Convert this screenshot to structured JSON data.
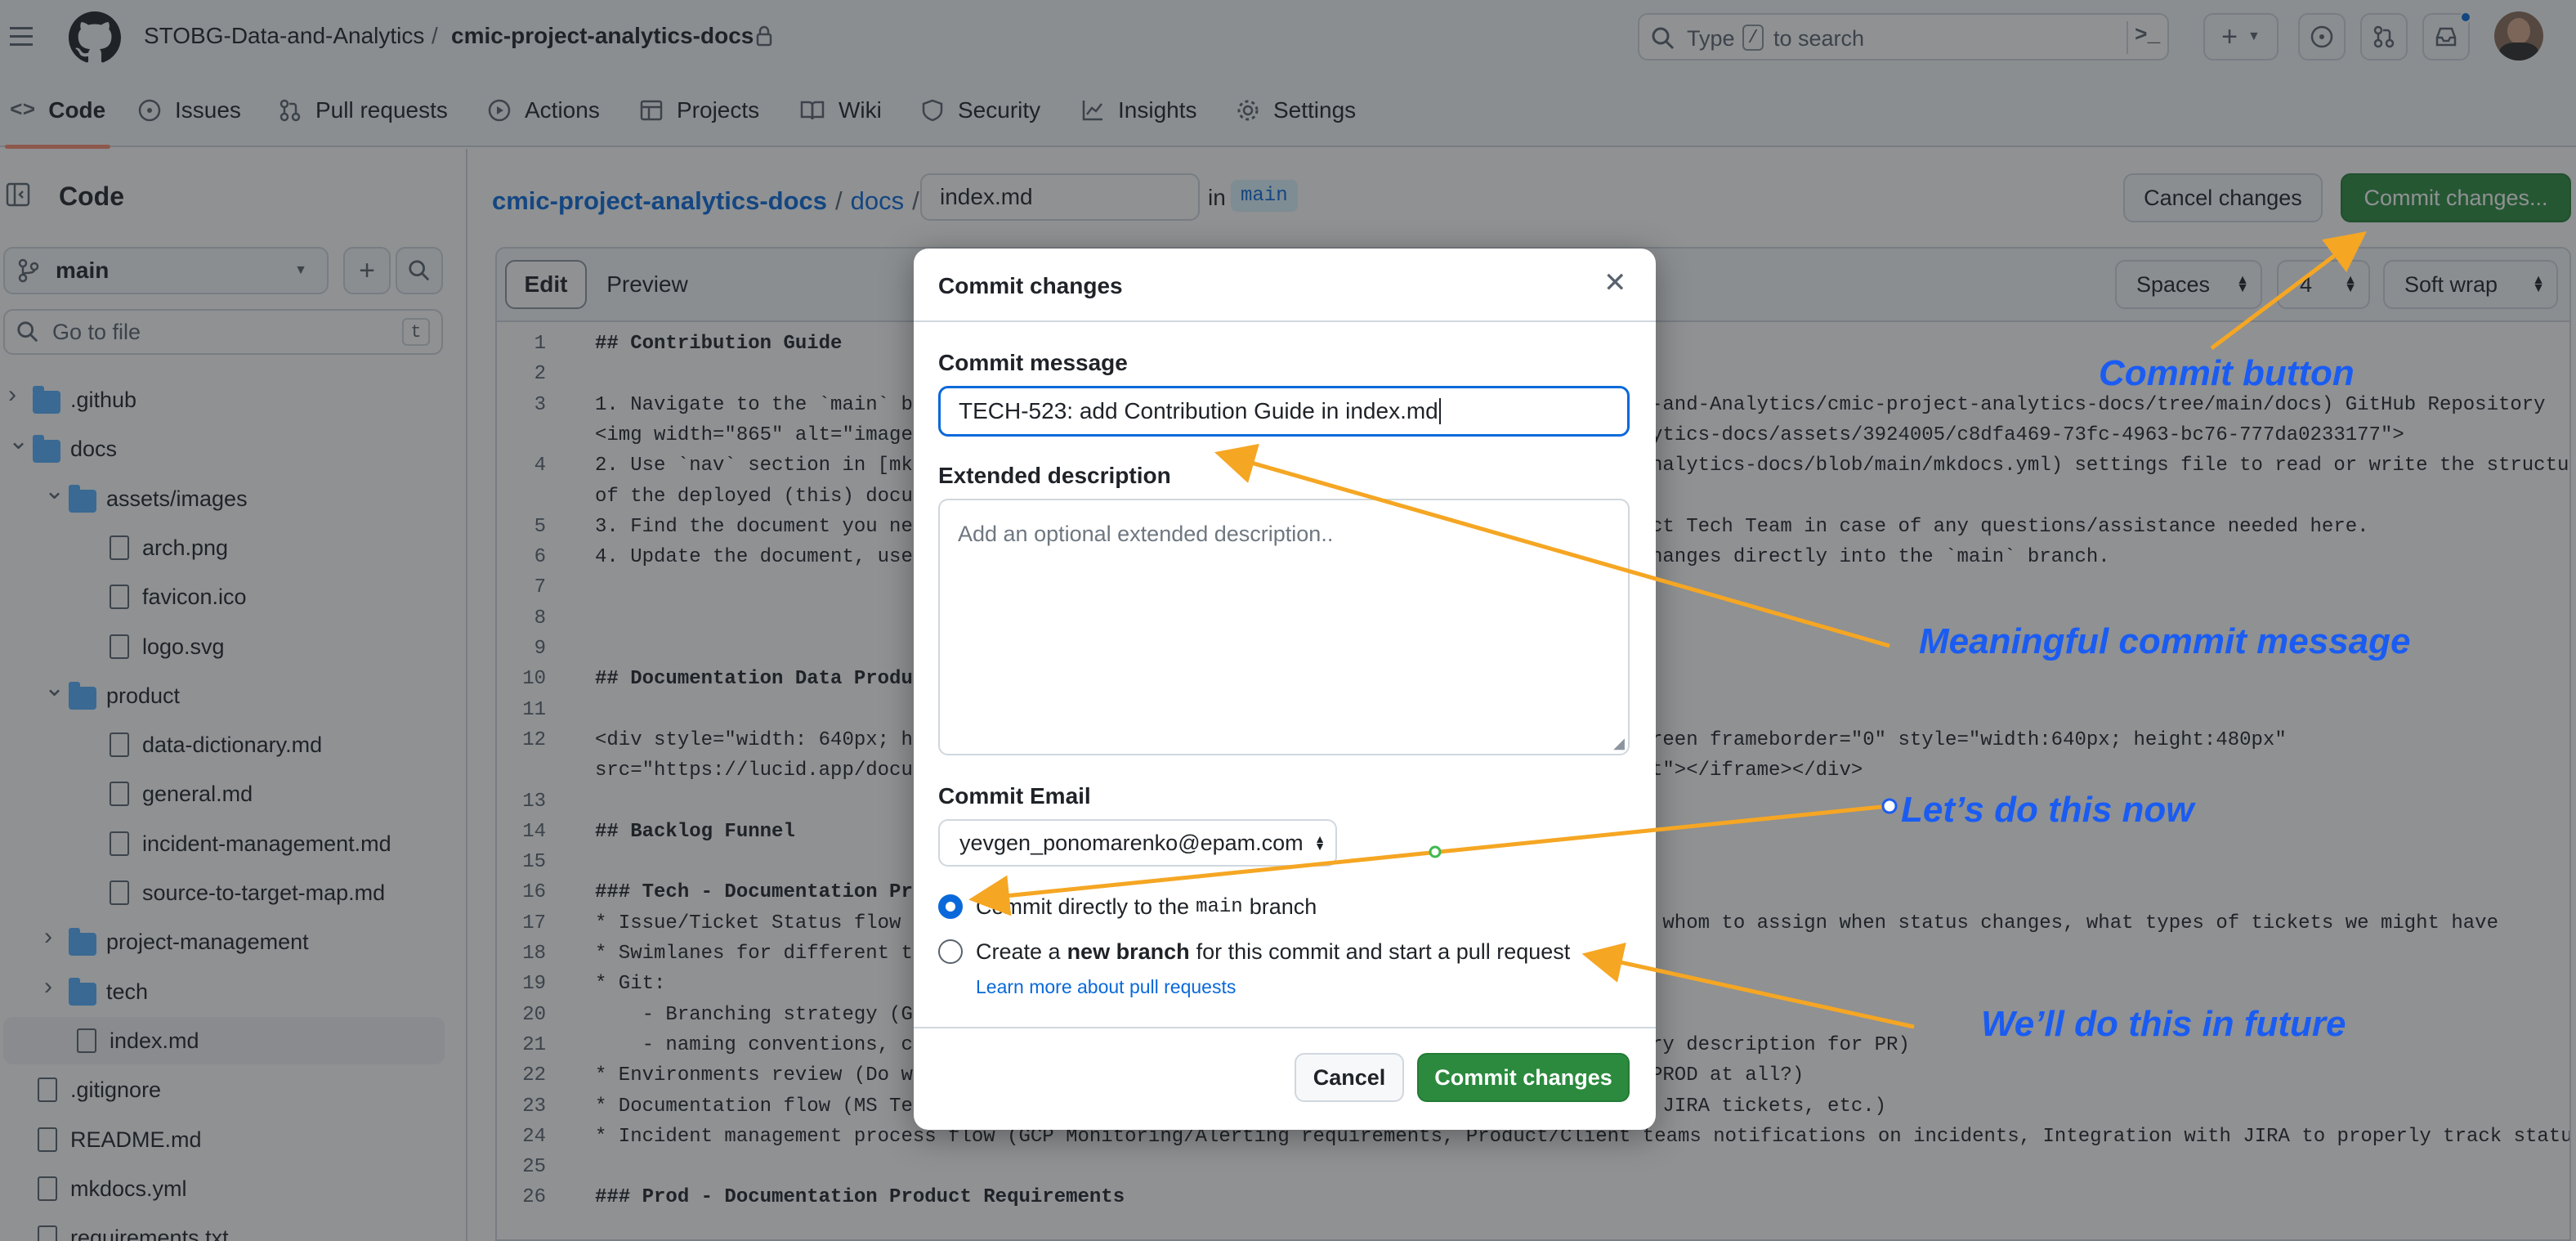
{
  "header": {
    "org": "STOBG-Data-and-Analytics",
    "separator": "/",
    "repo": "cmic-project-analytics-docs",
    "search_prefix": "Type",
    "search_key": "/",
    "search_suffix": "to search"
  },
  "repo_nav": [
    {
      "label": "Code",
      "icon": "code-icon"
    },
    {
      "label": "Issues",
      "icon": "issue-icon"
    },
    {
      "label": "Pull requests",
      "icon": "pull-request-icon"
    },
    {
      "label": "Actions",
      "icon": "play-icon"
    },
    {
      "label": "Projects",
      "icon": "table-icon"
    },
    {
      "label": "Wiki",
      "icon": "book-icon"
    },
    {
      "label": "Security",
      "icon": "shield-icon"
    },
    {
      "label": "Insights",
      "icon": "graph-icon"
    },
    {
      "label": "Settings",
      "icon": "gear-icon"
    }
  ],
  "sidebar": {
    "title": "Code",
    "branch": "main",
    "go_to_file_placeholder": "Go to file",
    "go_to_file_key": "t",
    "tree": [
      {
        "label": ".github",
        "type": "folder",
        "expanded": false
      },
      {
        "label": "docs",
        "type": "folder",
        "expanded": true
      },
      {
        "label": "assets/images",
        "type": "folder",
        "expanded": true
      },
      {
        "label": "arch.png",
        "type": "file"
      },
      {
        "label": "favicon.ico",
        "type": "file"
      },
      {
        "label": "logo.svg",
        "type": "file"
      },
      {
        "label": "product",
        "type": "folder",
        "expanded": true
      },
      {
        "label": "data-dictionary.md",
        "type": "file"
      },
      {
        "label": "general.md",
        "type": "file"
      },
      {
        "label": "incident-management.md",
        "type": "file"
      },
      {
        "label": "source-to-target-map.md",
        "type": "file"
      },
      {
        "label": "project-management",
        "type": "folder",
        "expanded": false
      },
      {
        "label": "tech",
        "type": "folder",
        "expanded": false
      },
      {
        "label": "index.md",
        "type": "file",
        "selected": true
      },
      {
        "label": ".gitignore",
        "type": "file"
      },
      {
        "label": "README.md",
        "type": "file"
      },
      {
        "label": "mkdocs.yml",
        "type": "file"
      },
      {
        "label": "requirements.txt",
        "type": "file"
      }
    ]
  },
  "breadcrumb": {
    "repo": "cmic-project-analytics-docs",
    "folder": "docs",
    "filename": "index.md",
    "in_label": "in",
    "branch": "main"
  },
  "actions": {
    "cancel": "Cancel changes",
    "commit": "Commit changes..."
  },
  "editor": {
    "tab_edit": "Edit",
    "tab_preview": "Preview",
    "indent_mode": "Spaces",
    "indent_size": "4",
    "wrap_mode": "Soft wrap",
    "lines": [
      {
        "n": "1",
        "text": "## Contribution Guide"
      },
      {
        "n": "2",
        "text": ""
      },
      {
        "n": "3",
        "text": "1. Navigate to the `main` bra"
      },
      {
        "n": "",
        "text": "<img width=\"865\" alt=\"image\""
      },
      {
        "n": "4",
        "text": "2. Use `nav` section in [mkdc"
      },
      {
        "n": "",
        "text": "of the deployed (this) docume"
      },
      {
        "n": "5",
        "text": "3. Find the document you need"
      },
      {
        "n": "6",
        "text": "4. Update the document, use *"
      },
      {
        "n": "7",
        "text": ""
      },
      {
        "n": "8",
        "text": ""
      },
      {
        "n": "9",
        "text": ""
      },
      {
        "n": "10",
        "text": "## Documentation Data Product"
      },
      {
        "n": "11",
        "text": ""
      },
      {
        "n": "12",
        "text": "<div style=\"width: 640px; hei"
      },
      {
        "n": "",
        "text": "src=\"https://lucid.app/docume"
      },
      {
        "n": "13",
        "text": ""
      },
      {
        "n": "14",
        "text": "## Backlog Funnel"
      },
      {
        "n": "15",
        "text": ""
      },
      {
        "n": "16",
        "text": "### Tech - Documentation Proc"
      },
      {
        "n": "17",
        "text": "* Issue/Ticket Status flow -"
      },
      {
        "n": "18",
        "text": "* Swimlanes for different tic"
      },
      {
        "n": "19",
        "text": "* Git:"
      },
      {
        "n": "20",
        "text": "    - Branching strategy (Git"
      },
      {
        "n": "21",
        "text": "    - naming conventions, com"
      },
      {
        "n": "22",
        "text": "* Environments review (Do we"
      },
      {
        "n": "23",
        "text": "* Documentation flow (MS Team"
      },
      {
        "n": "24",
        "text": "* Incident management process flow (GCP Monitoring/Alerting requirements, Product/Client teams notifications on incidents, Integration with JIRA to properly track status)"
      },
      {
        "n": "25",
        "text": ""
      },
      {
        "n": "26",
        "text": "### Prod - Documentation Product Requirements"
      }
    ],
    "right_fragments": [
      {
        "row": 2,
        "text": "-and-Analytics/cmic-project-analytics-docs/tree/main/docs) GitHub Repository"
      },
      {
        "row": 3,
        "text": "ytics-docs/assets/3924005/c8dfa469-73fc-4963-bc76-777da0233177\">"
      },
      {
        "row": 4,
        "text": "nalytics-docs/blob/main/mkdocs.yml) settings file to read or write the structure"
      },
      {
        "row": 6,
        "text": "ct Tech Team in case of any questions/assistance needed here."
      },
      {
        "row": 7,
        "text": "hanges directly into the `main` branch."
      },
      {
        "row": 13,
        "text": "reen frameborder=\"0\" style=\"width:640px; height:480px\""
      },
      {
        "row": 14,
        "text": "t\"></iframe></div>"
      },
      {
        "row": 19,
        "text": " whom to assign when status changes, what types of tickets we might have"
      },
      {
        "row": 23,
        "text": "ry description for PR)"
      },
      {
        "row": 24,
        "text": "PROD at all?)"
      },
      {
        "row": 25,
        "text": " JIRA tickets, etc.)"
      }
    ]
  },
  "modal": {
    "title": "Commit changes",
    "message_label": "Commit message",
    "message_value": "TECH-523: add Contribution Guide in index.md",
    "description_label": "Extended description",
    "description_placeholder": "Add an optional extended description..",
    "email_label": "Commit Email",
    "email_value": "yevgen_ponomarenko@epam.com",
    "option_direct_prefix": "Commit directly to the",
    "option_direct_branch": "main",
    "option_direct_suffix": "branch",
    "option_branch_prefix": "Create a",
    "option_branch_bold": "new branch",
    "option_branch_suffix": "for this commit and start a pull request",
    "learn_more": "Learn more about pull requests",
    "cancel": "Cancel",
    "commit": "Commit changes",
    "selected_option": "direct"
  },
  "annotations": {
    "commit_button": "Commit button",
    "commit_message": "Meaningful commit message",
    "do_now": "Let’s do this now",
    "do_future": "We’ll do this in future",
    "arrow_color": "#f5a623",
    "text_color": "#1a5cf2"
  },
  "colors": {
    "primary_green": "#2b8a3e",
    "accent_blue": "#0969da",
    "nav_underline": "#fd8c73"
  }
}
